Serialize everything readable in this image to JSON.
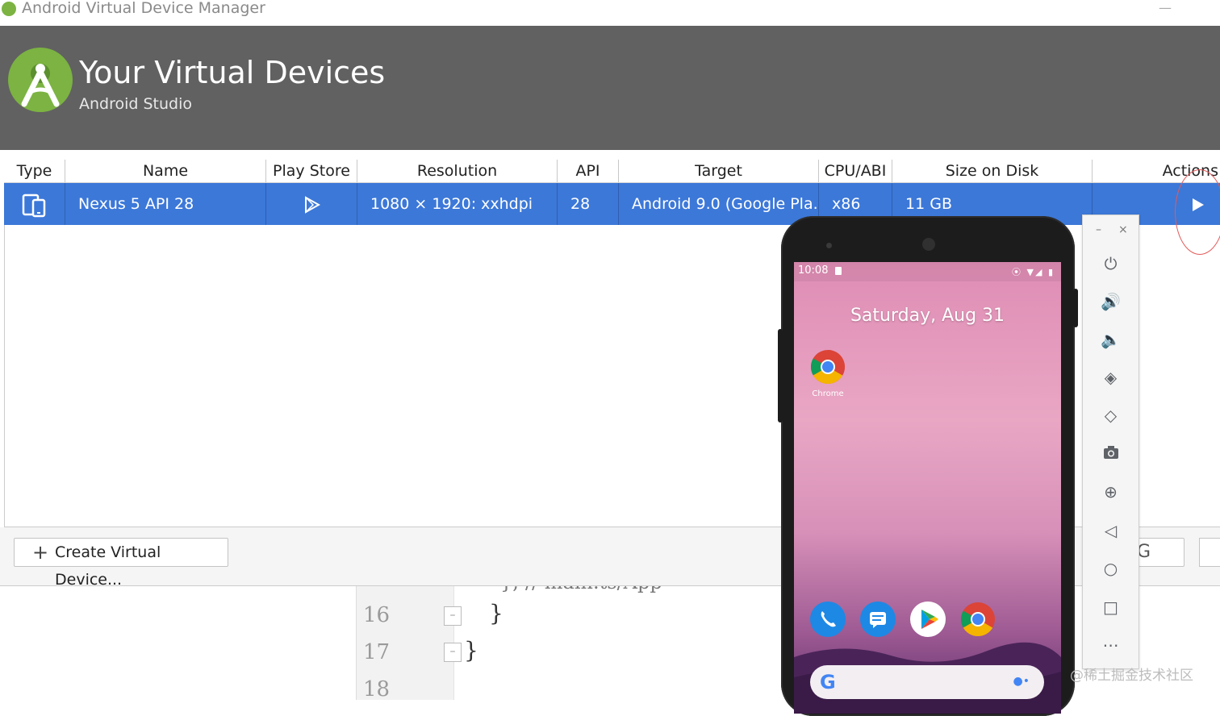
{
  "window": {
    "title": "Android Virtual Device Manager",
    "minimize": "—"
  },
  "header": {
    "title": "Your Virtual Devices",
    "subtitle": "Android Studio"
  },
  "table": {
    "columns": [
      "Type",
      "Name",
      "Play Store",
      "Resolution",
      "API",
      "Target",
      "CPU/ABI",
      "Size on Disk",
      "Actions"
    ],
    "rows": [
      {
        "type_icon": "phone-tablet-icon",
        "name": "Nexus 5 API 28",
        "play_store_icon": "play-store-icon",
        "resolution": "1080 × 1920: xxhdpi",
        "api": "28",
        "target": "Android 9.0 (Google Pla...",
        "cpu_abi": "x86",
        "size_on_disk": "11 GB",
        "action_icon": "launch-play-icon"
      }
    ]
  },
  "footer": {
    "create_label": "Create Virtual Device...",
    "create_icon": "plus-icon",
    "refresh_fragment": "G"
  },
  "editor": {
    "line_numbers": [
      "16",
      "17",
      "18"
    ],
    "lines": [
      "}",
      "}"
    ],
    "cut_line": "}; // main.ts/App"
  },
  "emulator": {
    "status_time": "10:08",
    "date": "Saturday, Aug 31",
    "home_app_label": "Chrome",
    "dock": [
      "phone-icon",
      "messages-icon",
      "play-store-icon",
      "chrome-icon"
    ],
    "toolbar": {
      "window_buttons": [
        "–",
        "×"
      ],
      "buttons": [
        "power-icon",
        "volume-up-icon",
        "volume-down-icon",
        "rotate-left-icon",
        "rotate-right-icon",
        "camera-icon",
        "zoom-icon",
        "back-icon",
        "home-icon",
        "overview-icon",
        "more-icon"
      ]
    }
  },
  "watermark": "@稀土掘金技术社区",
  "colors": {
    "header_bg": "#616161",
    "selection": "#3c78d8",
    "logo_green": "#7cb342"
  }
}
